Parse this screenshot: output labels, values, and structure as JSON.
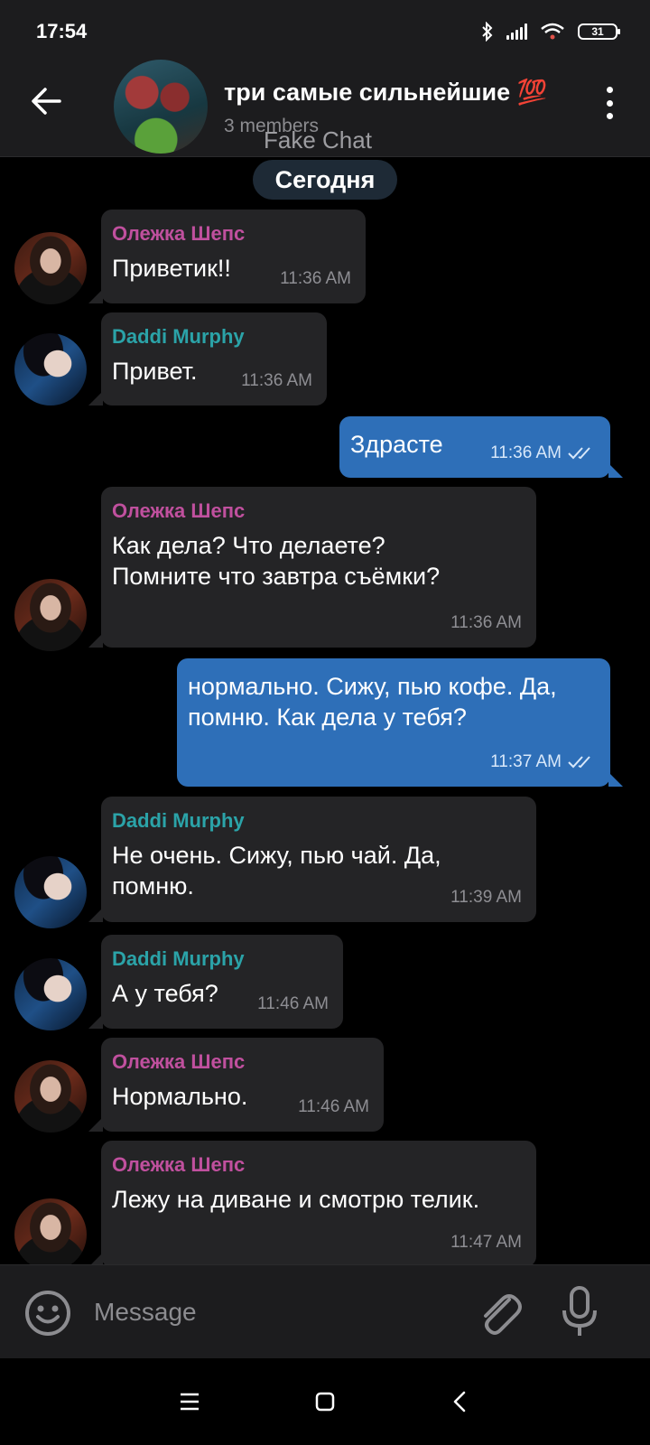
{
  "status_bar": {
    "time": "17:54",
    "battery": "31",
    "icons": [
      "bluetooth-icon",
      "signal-icon",
      "wifi-icon",
      "battery-icon"
    ]
  },
  "header": {
    "title": "три самые сильнейшие 💯",
    "members": "3 members",
    "watermark": "Fake Chat"
  },
  "date_divider": "Сегодня",
  "colors": {
    "incoming_bubble": "#242426",
    "outgoing_bubble": "#2e6fb8",
    "sender_oleg": "#c0509e",
    "sender_daddi": "#2ba3a8",
    "background": "#000000"
  },
  "messages": [
    {
      "sender": "Олежка Шепс",
      "text": "Приветик!!",
      "time": "11:36 AM",
      "direction": "in"
    },
    {
      "sender": "Daddi Murphy",
      "text": "Привет.",
      "time": "11:36 AM",
      "direction": "in"
    },
    {
      "text": "Здрасте",
      "time": "11:36 AM",
      "direction": "out",
      "status": "read"
    },
    {
      "sender": "Олежка Шепс",
      "text": "Как дела? Что делаете? Помните что завтра съёмки?",
      "time": "11:36 AM",
      "direction": "in"
    },
    {
      "text": "нормально. Сижу, пью кофе. Да, помню. Как дела у тебя?",
      "time": "11:37 AM",
      "direction": "out",
      "status": "read"
    },
    {
      "sender": "Daddi Murphy",
      "text": "Не очень. Сижу, пью чай. Да, помню.",
      "time": "11:39 AM",
      "direction": "in"
    },
    {
      "sender": "Daddi Murphy",
      "text": "А у тебя?",
      "time": "11:46 AM",
      "direction": "in"
    },
    {
      "sender": "Олежка Шепс",
      "text": "Нормально.",
      "time": "11:46 AM",
      "direction": "in"
    },
    {
      "sender": "Олежка Шепс",
      "text": "Лежу на диване и смотрю телик.",
      "time": "11:47 AM",
      "direction": "in"
    }
  ],
  "input": {
    "placeholder": "Message",
    "value": ""
  },
  "nav": [
    "menu-icon",
    "home-icon",
    "back-icon"
  ]
}
